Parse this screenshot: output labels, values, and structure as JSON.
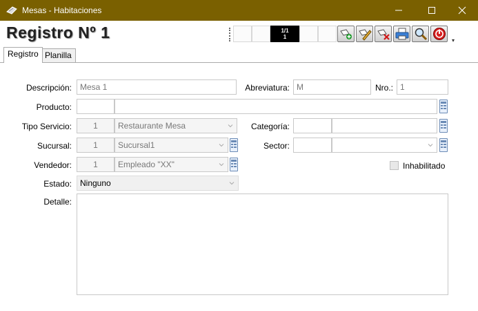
{
  "window": {
    "title": "Mesas - Habitaciones"
  },
  "header": {
    "record_title": "Registro Nº  1"
  },
  "navigator": {
    "position": "1/1",
    "count": "1"
  },
  "toolbar": {
    "icons": [
      "add-record-icon",
      "edit-record-icon",
      "delete-record-icon",
      "print-icon",
      "search-icon",
      "exit-icon"
    ]
  },
  "tabs": [
    {
      "label": "Registro",
      "active": true
    },
    {
      "label": "Planilla",
      "active": false
    }
  ],
  "form": {
    "descripcion": {
      "label": "Descripción:",
      "value": "Mesa 1"
    },
    "abreviatura": {
      "label": "Abreviatura:",
      "value": "M"
    },
    "nro": {
      "label": "Nro.:",
      "value": "1"
    },
    "producto": {
      "label": "Producto:",
      "code": "",
      "value": ""
    },
    "tipo_servicio": {
      "label": "Tipo Servicio:",
      "code": "1",
      "value": "Restaurante Mesa"
    },
    "categoria": {
      "label": "Categoría:",
      "code": "",
      "value": ""
    },
    "sucursal": {
      "label": "Sucursal:",
      "code": "1",
      "value": "Sucursal1"
    },
    "sector": {
      "label": "Sector:",
      "code": "",
      "value": ""
    },
    "vendedor": {
      "label": "Vendedor:",
      "code": "1",
      "value": "Empleado \"XX\""
    },
    "inhabilitado": {
      "label": "Inhabilitado",
      "checked": false
    },
    "estado": {
      "label": "Estado:",
      "value": "Ninguno"
    },
    "detalle": {
      "label": "Detalle:",
      "value": ""
    }
  },
  "colors": {
    "titlebar": "#7a6000",
    "lookup_border": "#6a8ab5"
  }
}
